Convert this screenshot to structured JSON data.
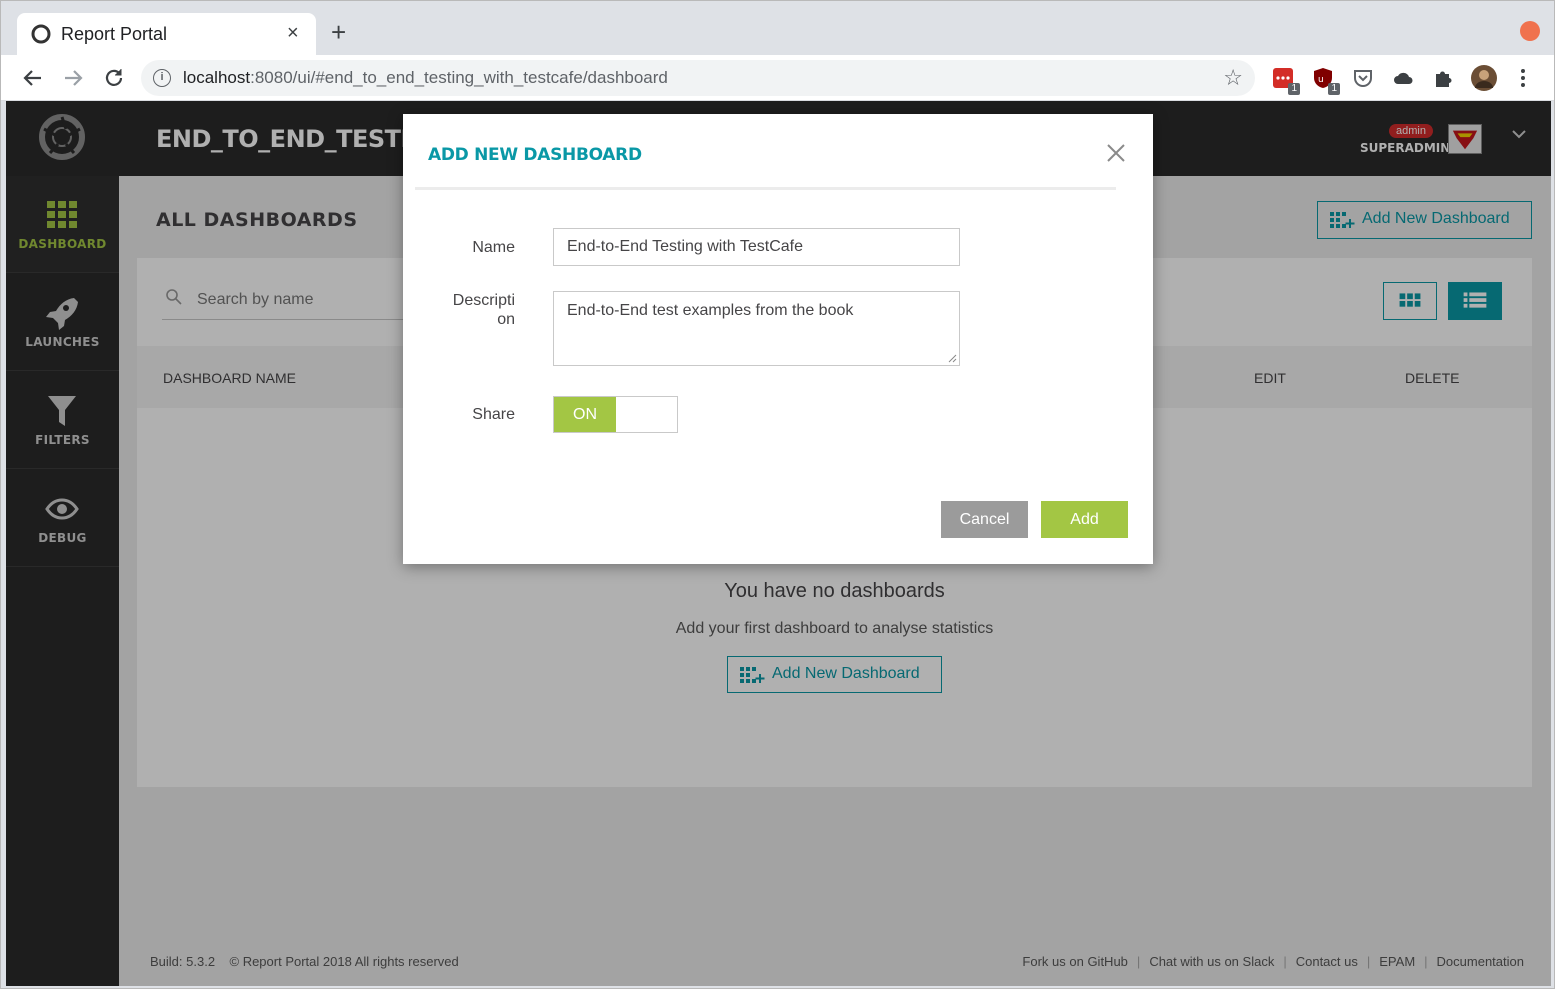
{
  "browser": {
    "tab_title": "Report Portal",
    "tab_close": "×",
    "new_tab": "+",
    "url_host": "localhost",
    "url_rest": ":8080/ui/#end_to_end_testing_with_testcafe/dashboard",
    "ext_badges": [
      "1",
      "1"
    ],
    "icons": [
      "back-icon",
      "forward-icon",
      "reload-icon",
      "info-icon",
      "star-icon",
      "lastpass-icon",
      "ublock-icon",
      "pocket-icon",
      "cloud-icon",
      "puzzle-icon",
      "profile-icon",
      "menu-icon"
    ]
  },
  "sidebar": {
    "items": [
      {
        "label": "DASHBOARD",
        "icon": "grid-icon",
        "active": true
      },
      {
        "label": "LAUNCHES",
        "icon": "rocket-icon",
        "active": false
      },
      {
        "label": "FILTERS",
        "icon": "filter-icon",
        "active": false
      },
      {
        "label": "DEBUG",
        "icon": "eye-icon",
        "active": false
      }
    ]
  },
  "header": {
    "project_title": "END_TO_END_TESTING_WI",
    "role_badge": "admin",
    "user_name": "SUPERADMIN"
  },
  "page": {
    "title": "ALL DASHBOARDS",
    "add_button": "Add New Dashboard",
    "search_placeholder": "Search by name",
    "columns": [
      "DASHBOARD NAME",
      "EDIT",
      "DELETE"
    ],
    "empty_title": "You have no dashboards",
    "empty_sub": "Add your first dashboard to analyse statistics",
    "empty_add_button": "Add New Dashboard"
  },
  "footer": {
    "build": "Build: 5.3.2",
    "copyright": "© Report Portal 2018 All rights reserved",
    "links": [
      "Fork us on GitHub",
      "Chat with us on Slack",
      "Contact us",
      "EPAM",
      "Documentation"
    ]
  },
  "modal": {
    "title": "ADD NEW DASHBOARD",
    "name_label": "Name",
    "name_value": "End-to-End Testing with TestCafe",
    "description_label_1": "Descripti",
    "description_label_2": "on",
    "description_value": "End-to-End test examples from the book",
    "share_label": "Share",
    "share_state": "ON",
    "cancel_label": "Cancel",
    "add_label": "Add"
  },
  "colors": {
    "accent": "#0a98a6",
    "green": "#a3c644",
    "sidebar": "#2a2a2a"
  }
}
